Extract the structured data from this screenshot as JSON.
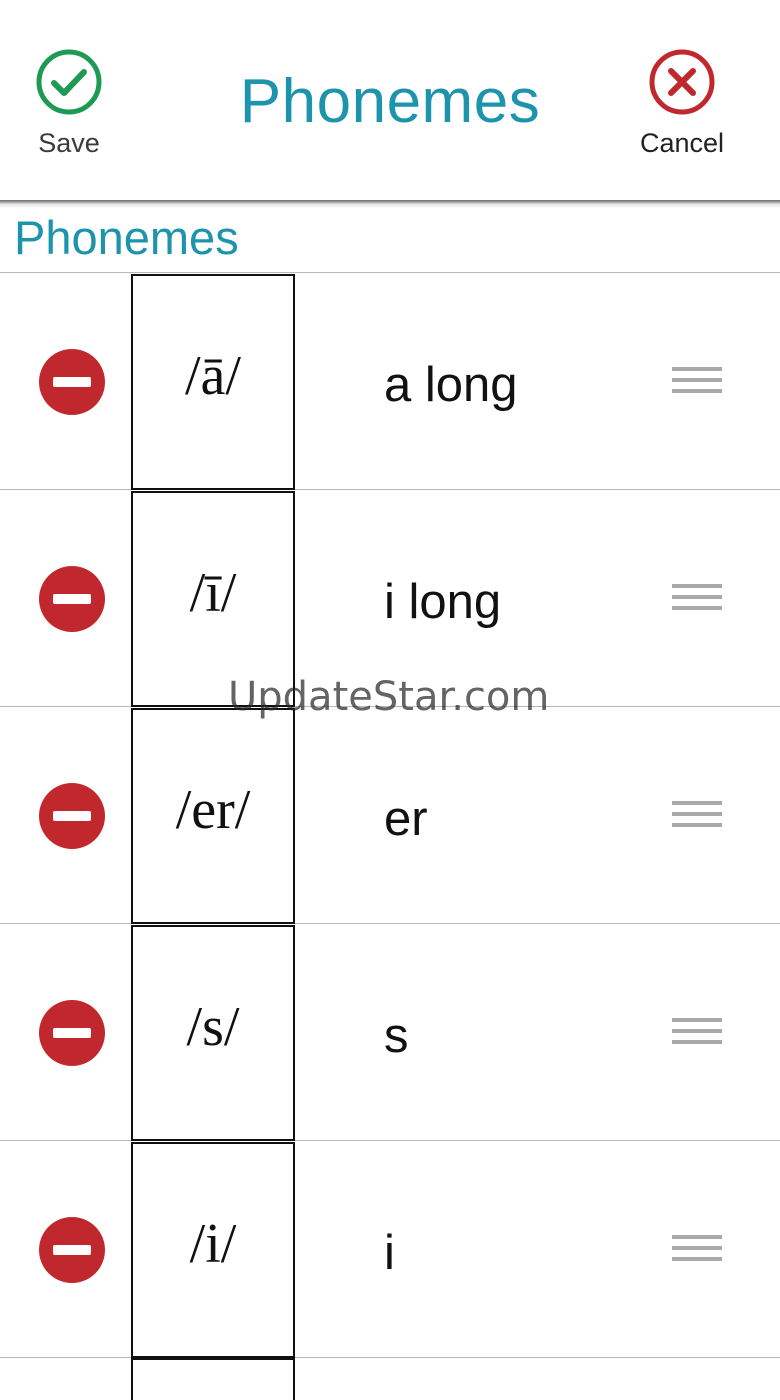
{
  "header": {
    "title": "Phonemes",
    "save_label": "Save",
    "cancel_label": "Cancel",
    "save_icon": "check-circle-icon",
    "cancel_icon": "x-circle-icon"
  },
  "section": {
    "title": "Phonemes"
  },
  "phonemes": [
    {
      "symbol": "/ā/",
      "name": "a long"
    },
    {
      "symbol": "/ī/",
      "name": "i long"
    },
    {
      "symbol": "/er/",
      "name": "er"
    },
    {
      "symbol": "/s/",
      "name": "s"
    },
    {
      "symbol": "/i/",
      "name": "i"
    }
  ],
  "icons": {
    "remove": "minus-circle-icon",
    "drag": "drag-handle-icon"
  },
  "colors": {
    "accent": "#1c94ac",
    "save_green": "#1f9a54",
    "danger_red": "#c0282d",
    "divider": "#b8b8b8"
  },
  "watermark": "UpdateStar.com"
}
